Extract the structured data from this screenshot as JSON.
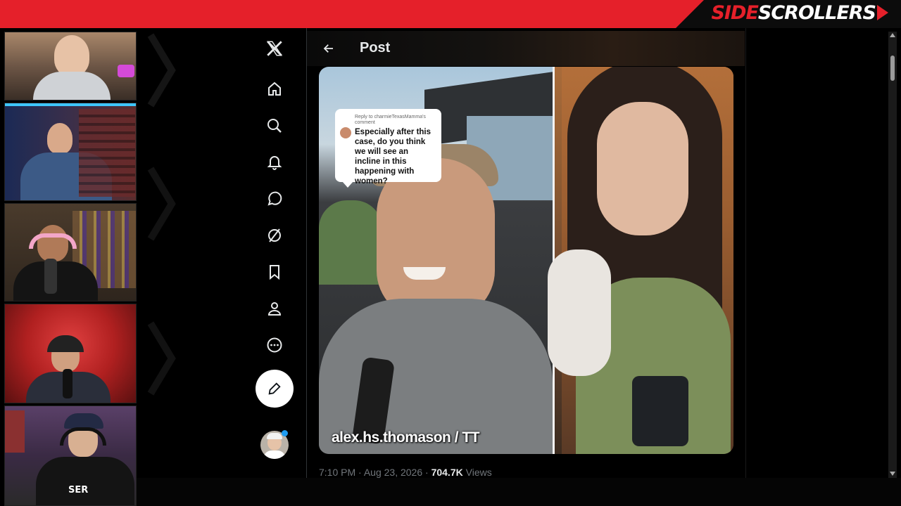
{
  "banner": {
    "brand_part1": "SIDE",
    "brand_part2": "SCROLLERS",
    "colors": {
      "red": "#e5202a",
      "dark": "#0c0c0c"
    }
  },
  "webcams": [
    {
      "label": "cam-host-1"
    },
    {
      "label": "cam-host-2"
    },
    {
      "label": "cam-host-3"
    },
    {
      "label": "cam-host-4"
    },
    {
      "label": "cam-host-5"
    }
  ],
  "x_sidebar": {
    "items": [
      {
        "name": "x-logo-icon"
      },
      {
        "name": "home-icon"
      },
      {
        "name": "search-icon"
      },
      {
        "name": "notifications-icon"
      },
      {
        "name": "messages-icon"
      },
      {
        "name": "grok-icon"
      },
      {
        "name": "bookmark-icon"
      },
      {
        "name": "profile-icon"
      },
      {
        "name": "more-icon"
      }
    ],
    "compose_icon": "compose-icon"
  },
  "post": {
    "header_title": "Post",
    "reply_ref": "Reply to charmieTexasMamma's comment",
    "reply_text": "Especially after this case, do you think we will see an incline in this happening with women?",
    "watermark": "alex.hs.thomason / TT",
    "time": "7:10 PM",
    "date": "Aug 23, 2026",
    "views_count": "704.7K",
    "views_label": "Views",
    "separator": "·"
  },
  "colors": {
    "accent_blue": "#1d9bf0",
    "text_primary": "#e7e9ea",
    "text_secondary": "#71767b"
  }
}
